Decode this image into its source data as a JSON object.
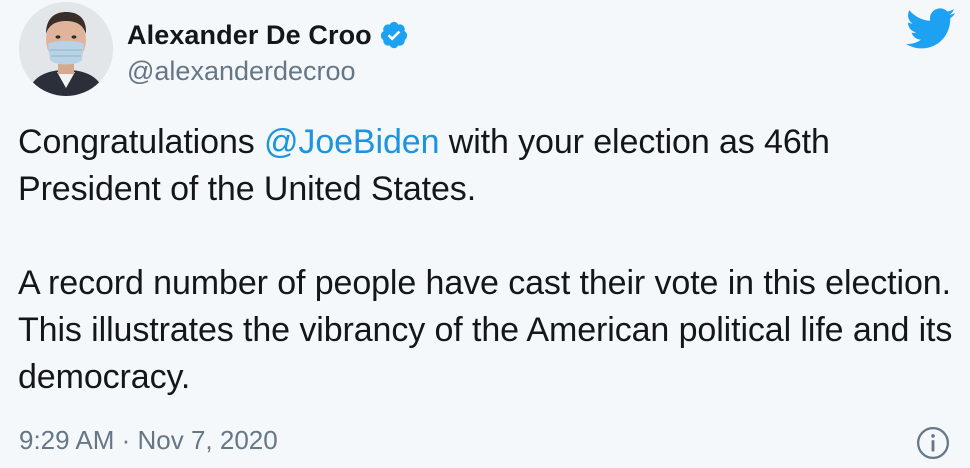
{
  "author": {
    "display_name": "Alexander De Croo",
    "handle": "@alexanderdecroo",
    "verified": true
  },
  "tweet": {
    "line1_before": "Congratulations ",
    "mention": "@JoeBiden",
    "line1_after": " with your election as 46th President of the United States.",
    "paragraph2": "A record number of people have cast their vote in this election. This illustrates the vibrancy of the American political life and its democracy."
  },
  "meta": {
    "time": "9:29 AM",
    "separator": " · ",
    "date": "Nov 7, 2020"
  },
  "colors": {
    "link": "#1b95e0",
    "brand": "#1da1f2",
    "muted": "#657786",
    "text": "#14171a",
    "background": "#f5f8fa"
  },
  "icons": {
    "brand_logo": "twitter-bird-icon",
    "verified": "verified-badge-icon",
    "info": "info-icon"
  }
}
